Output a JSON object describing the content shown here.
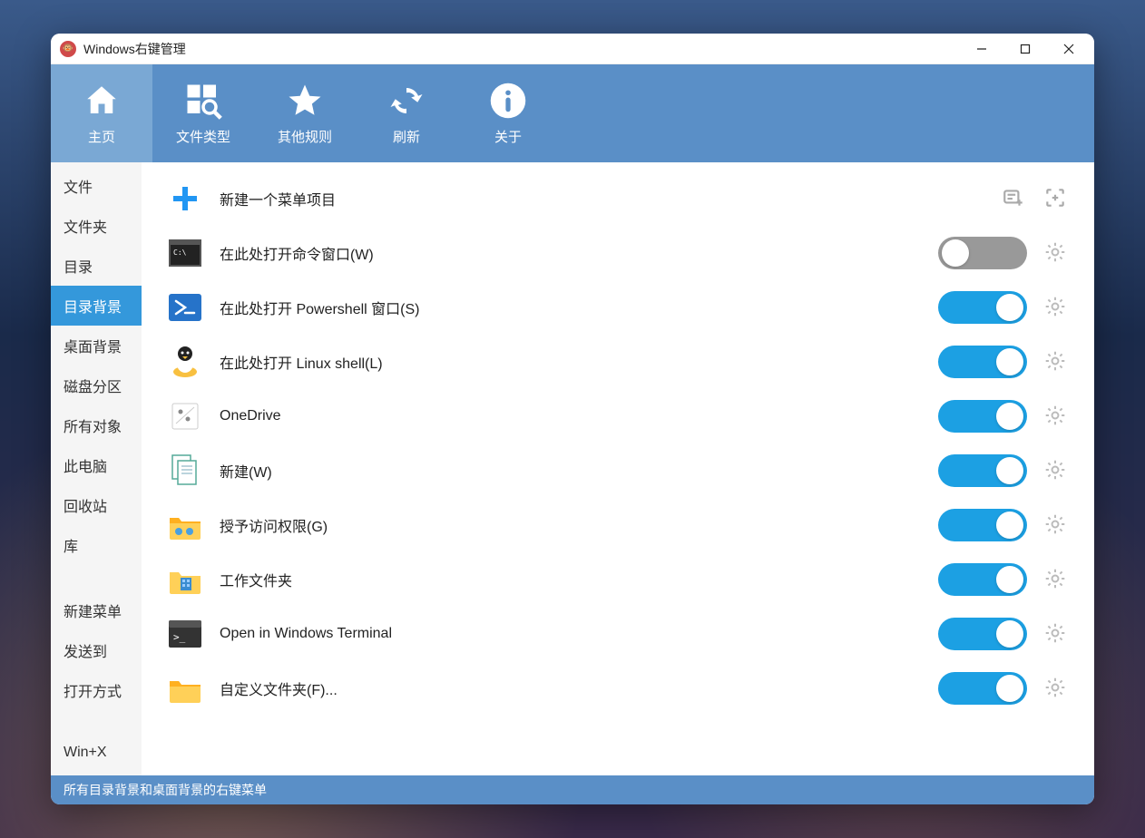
{
  "window": {
    "title": "Windows右键管理"
  },
  "toolbar": {
    "items": [
      {
        "label": "主页",
        "icon": "home",
        "active": true
      },
      {
        "label": "文件类型",
        "icon": "grid-search",
        "active": false
      },
      {
        "label": "其他规则",
        "icon": "star",
        "active": false
      },
      {
        "label": "刷新",
        "icon": "refresh",
        "active": false
      },
      {
        "label": "关于",
        "icon": "info",
        "active": false
      }
    ]
  },
  "sidebar": {
    "groups": [
      {
        "items": [
          {
            "label": "文件",
            "active": false
          },
          {
            "label": "文件夹",
            "active": false
          },
          {
            "label": "目录",
            "active": false
          },
          {
            "label": "目录背景",
            "active": true
          },
          {
            "label": "桌面背景",
            "active": false
          },
          {
            "label": "磁盘分区",
            "active": false
          },
          {
            "label": "所有对象",
            "active": false
          },
          {
            "label": "此电脑",
            "active": false
          },
          {
            "label": "回收站",
            "active": false
          },
          {
            "label": "库",
            "active": false
          }
        ]
      },
      {
        "items": [
          {
            "label": "新建菜单",
            "active": false
          },
          {
            "label": "发送到",
            "active": false
          },
          {
            "label": "打开方式",
            "active": false
          }
        ]
      },
      {
        "items": [
          {
            "label": "Win+X",
            "active": false
          }
        ]
      }
    ]
  },
  "content": {
    "header": {
      "label": "新建一个菜单项目",
      "icon": "plus"
    },
    "items": [
      {
        "label": "在此处打开命令窗口(W)",
        "icon": "cmd",
        "enabled": false
      },
      {
        "label": "在此处打开 Powershell 窗口(S)",
        "icon": "powershell",
        "enabled": true
      },
      {
        "label": "在此处打开 Linux shell(L)",
        "icon": "linux",
        "enabled": true
      },
      {
        "label": "OneDrive",
        "icon": "onedrive",
        "enabled": true
      },
      {
        "label": "新建(W)",
        "icon": "new-doc",
        "enabled": true
      },
      {
        "label": "授予访问权限(G)",
        "icon": "share-folder",
        "enabled": true
      },
      {
        "label": "工作文件夹",
        "icon": "work-folder",
        "enabled": true
      },
      {
        "label": "Open in Windows Terminal",
        "icon": "terminal",
        "enabled": true
      },
      {
        "label": "自定义文件夹(F)...",
        "icon": "folder",
        "enabled": true
      }
    ]
  },
  "statusbar": {
    "text": "所有目录背景和桌面背景的右键菜单"
  }
}
